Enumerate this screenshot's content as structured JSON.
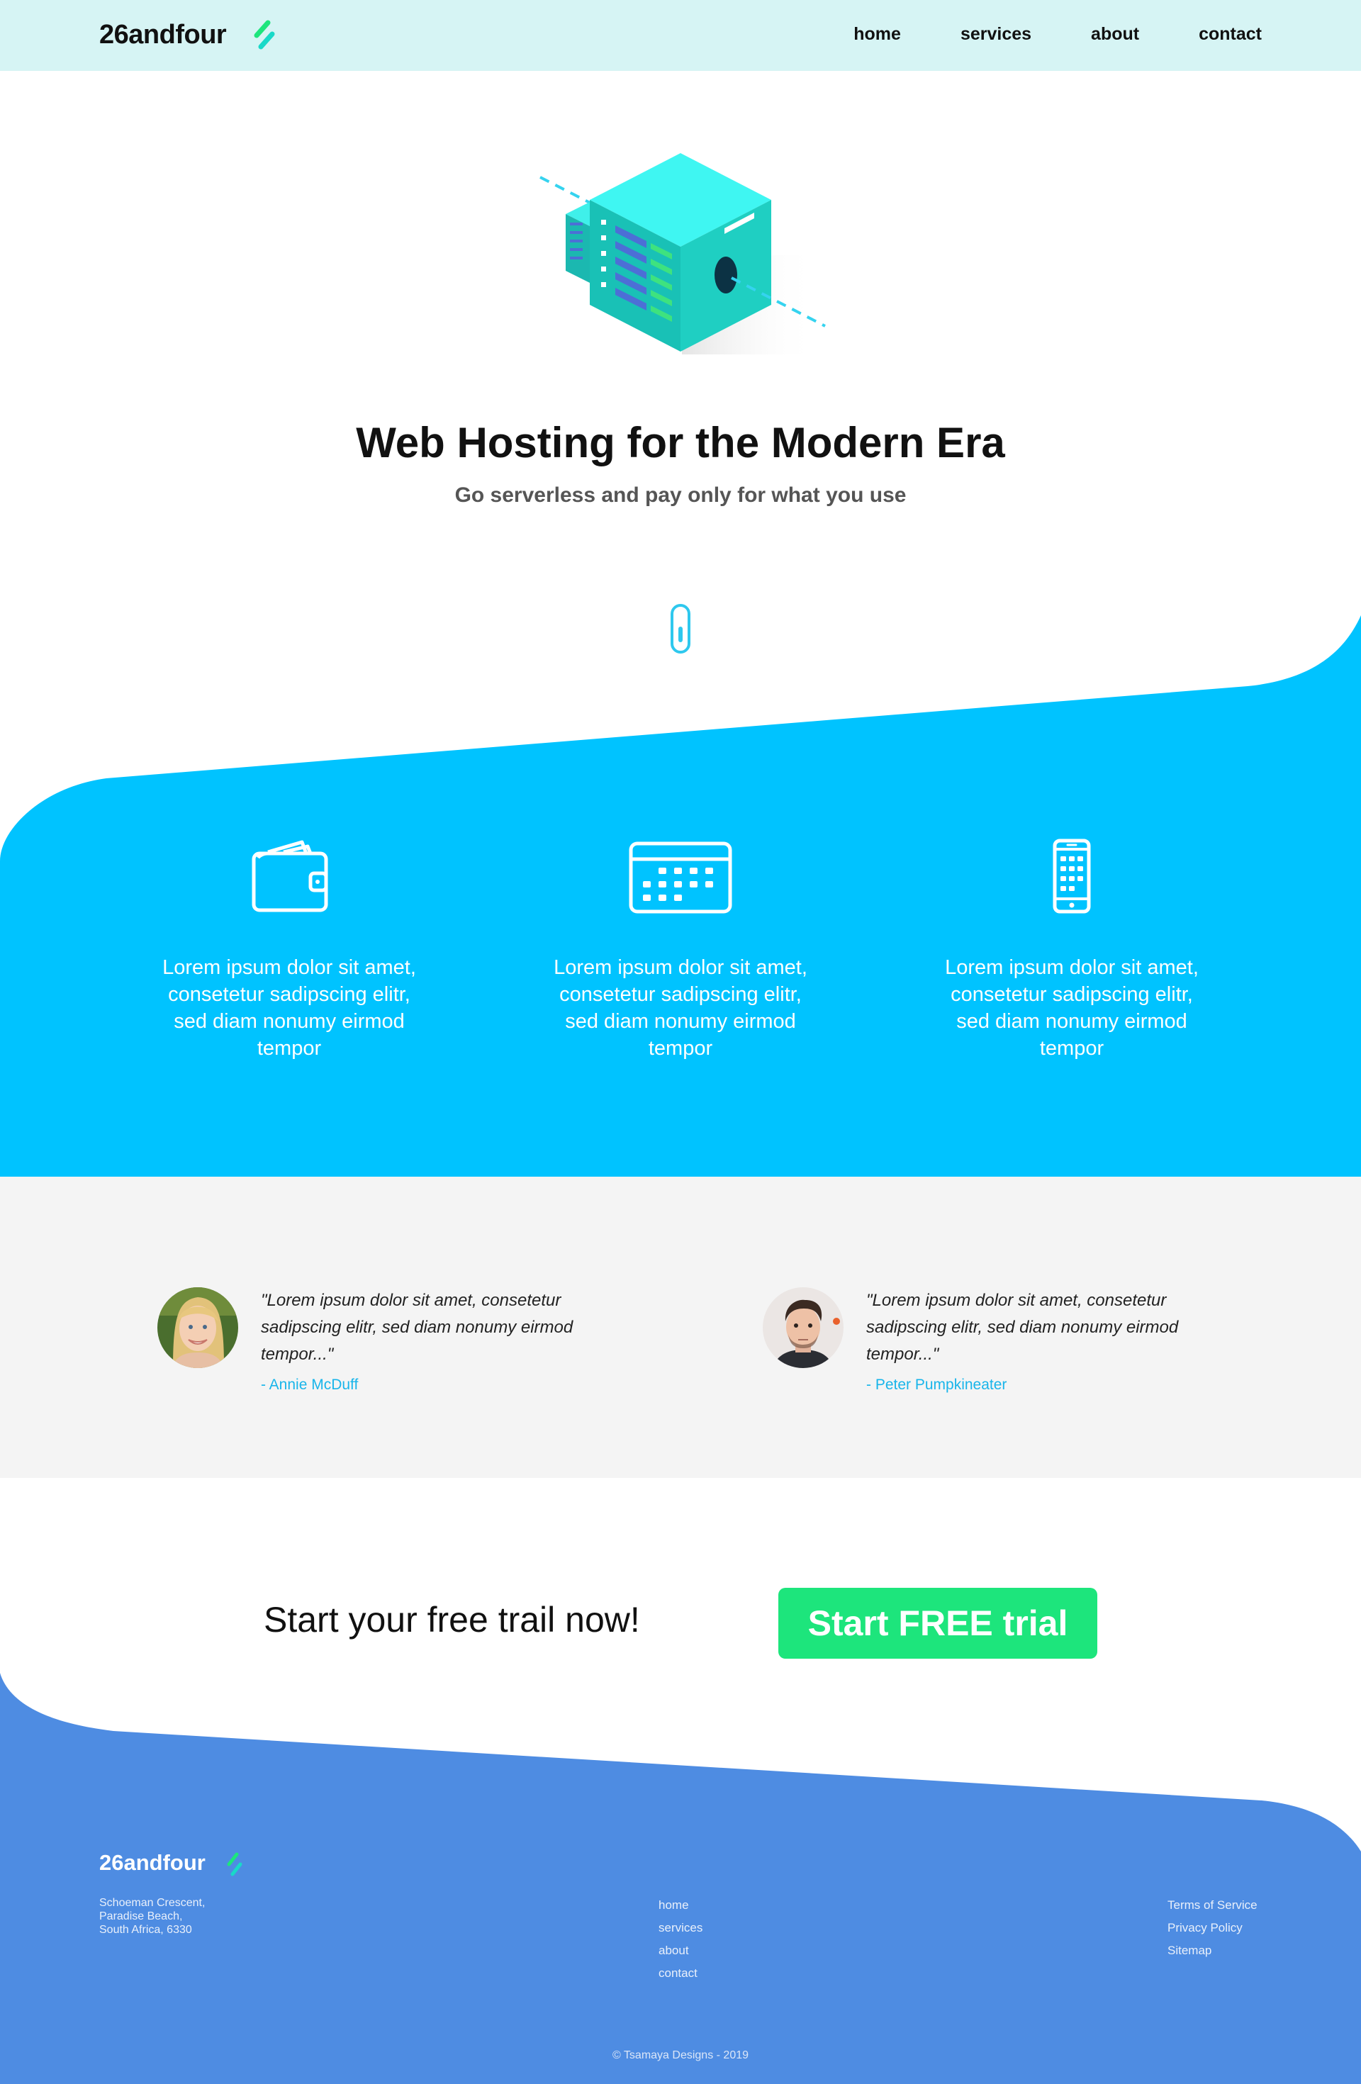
{
  "header": {
    "brand": "26andfour",
    "nav": [
      "home",
      "services",
      "about",
      "contact"
    ]
  },
  "hero": {
    "title": "Web Hosting for the Modern Era",
    "subtitle": "Go serverless and pay only for what you use"
  },
  "features": [
    {
      "icon": "wallet-icon",
      "text": "Lorem ipsum dolor sit amet, consetetur sadipscing elitr, sed diam nonumy eirmod tempor"
    },
    {
      "icon": "calendar-icon",
      "text": "Lorem ipsum dolor sit amet, consetetur sadipscing elitr, sed diam nonumy eirmod tempor"
    },
    {
      "icon": "mobile-phone-icon",
      "text": "Lorem ipsum dolor sit amet, consetetur sadipscing elitr, sed diam nonumy eirmod tempor"
    }
  ],
  "testimonials": [
    {
      "quote": "\"Lorem ipsum dolor sit amet, consetetur sadipscing elitr, sed diam nonumy eirmod tempor...\"",
      "author": "- Annie McDuff"
    },
    {
      "quote": "\"Lorem ipsum dolor sit amet, consetetur sadipscing elitr, sed diam nonumy eirmod tempor...\"",
      "author": "- Peter Pumpkineater"
    }
  ],
  "cta": {
    "text": "Start your free trail now!",
    "button": "Start FREE trial"
  },
  "footer": {
    "brand": "26andfour",
    "address": [
      "Schoeman Crescent,",
      "Paradise Beach,",
      "South Africa, 6330"
    ],
    "nav": [
      "home",
      "services",
      "about",
      "contact"
    ],
    "legal": [
      "Terms of Service",
      "Privacy Policy",
      "Sitemap"
    ],
    "copyright": "© Tsamaya Designs - 2019"
  },
  "colors": {
    "nav_bg": "#d6f4f4",
    "feature_blue": "#00c3ff",
    "testimonial_bg": "#f4f4f4",
    "author_accent": "#19b5ea",
    "cta_green": "#1de57c",
    "footer_blue": "#4e8ce2"
  }
}
